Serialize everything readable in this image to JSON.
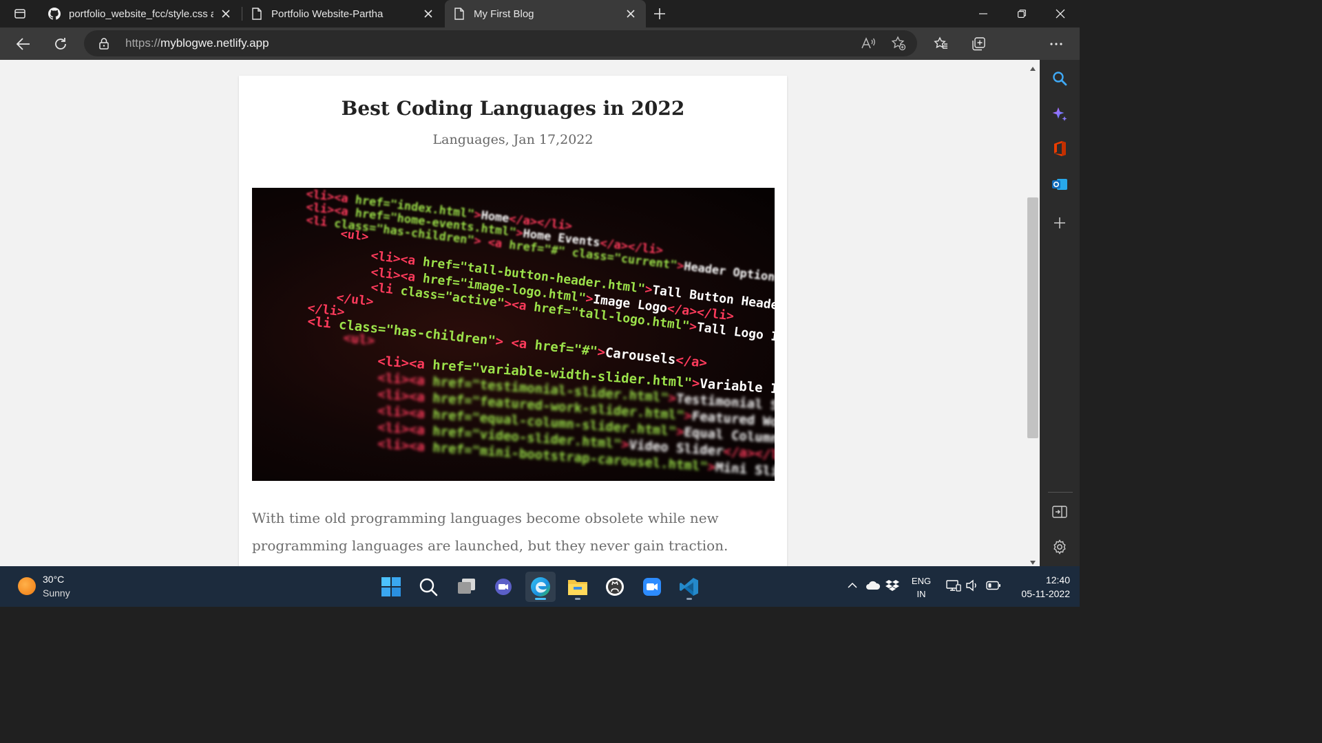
{
  "browser": {
    "tabs": [
      {
        "title": "portfolio_website_fcc/style.css at",
        "icon": "github-icon",
        "active": false
      },
      {
        "title": "Portfolio Website-Partha",
        "icon": "page-icon",
        "active": false
      },
      {
        "title": "My First Blog",
        "icon": "page-icon",
        "active": true
      }
    ],
    "address": {
      "scheme": "https://",
      "host": "myblogwe.netlify.app"
    }
  },
  "page": {
    "post_title": "Best Coding Languages in 2022",
    "post_meta": "Languages, Jan 17,2022",
    "image_icon": "code-screenshot-image",
    "body_text": "With time old programming languages become obsolete while new programming languages are launched, but they never gain traction."
  },
  "code_image_lines": [
    "<li><a href=\"index.html\">Home</a></li>",
    "<li><a href=\"home-events.html\">Home Events</a></li>",
    "<li class=\"has-children\"> <a href=\"#\" class=\"current\">Header Options</a>",
    "<ul>",
    "<li><a href=\"tall-button-header.html\">Tall Button Header</a></li>",
    "<li><a href=\"image-logo.html\">Image Logo</a></li>",
    "<li class=\"active\"><a href=\"tall-logo.html\">Tall Logo Image</a></li>",
    "</ul>",
    "</li>",
    "<li class=\"has-children\"> <a href=\"#\">Carousels</a>",
    "<ul>",
    "<li><a href=\"variable-width-slider.html\">Variable Image Wi",
    "<li><a href=\"testimonial-slider.html\">Testimonial Slider</",
    "<li><a href=\"featured-work-slider.html\">Featured Work Sli",
    "<li><a href=\"equal-column-slider.html\">Equal Column Slid",
    "<li><a href=\"video-slider.html\">Video Slider</a></li>",
    "<li><a href=\"mini-bootstrap-carousel.html\">Mini Slider<"
  ],
  "taskbar": {
    "weather": {
      "temp": "30°C",
      "desc": "Sunny"
    },
    "apps": [
      "windows-start-icon",
      "search-icon",
      "task-view-icon",
      "teams-chat-icon",
      "edge-icon",
      "file-explorer-icon",
      "github-desktop-icon",
      "zoom-icon",
      "vscode-icon"
    ],
    "lang": {
      "line1": "ENG",
      "line2": "IN"
    },
    "clock": {
      "time": "12:40",
      "date": "05-11-2022"
    }
  },
  "colors": {
    "accent": "#4cc2ff",
    "tab_bar": "#202020",
    "toolbar": "#3a3a3a",
    "taskbar": "#1c2b3d",
    "code_tag": "#ff3b5c",
    "code_attr": "#9be14a",
    "code_text": "#ffffff"
  }
}
